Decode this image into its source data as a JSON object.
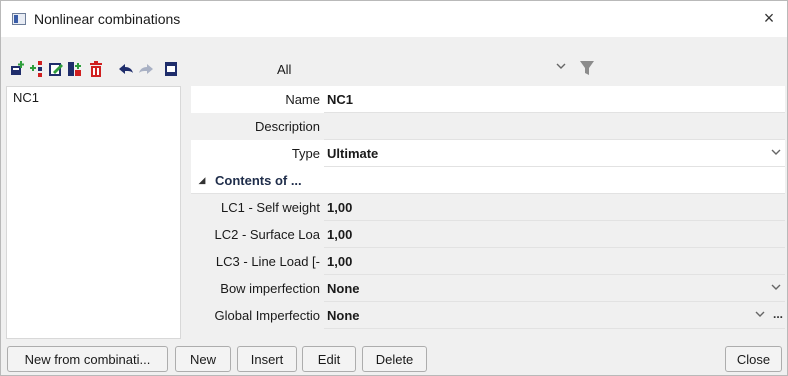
{
  "window": {
    "title": "Nonlinear combinations",
    "close_glyph": "×"
  },
  "toolbar": {
    "icons": [
      "add-icon",
      "insert-icon",
      "edit-icon",
      "copy-icon",
      "delete-icon",
      "undo-icon",
      "redo-icon",
      "window-icon",
      "filter-icon"
    ],
    "filter_value": "All",
    "accent_colors": {
      "green": "#2e9e3c",
      "red": "#d02020",
      "navy": "#1f2d6b",
      "gray": "#8c8c8c"
    }
  },
  "list": {
    "items": [
      "NC1"
    ]
  },
  "properties": {
    "name_label": "Name",
    "name_value": "NC1",
    "description_label": "Description",
    "description_value": "",
    "type_label": "Type",
    "type_value": "Ultimate",
    "section_title": "Contents of ...",
    "lc1_label": "LC1 - Self weight",
    "lc1_value": "1,00",
    "lc2_label": "LC2 - Surface Loa",
    "lc2_value": "1,00",
    "lc3_label": "LC3 - Line Load [-",
    "lc3_value": "1,00",
    "bow_label": "Bow imperfection",
    "bow_value": "None",
    "global_label": "Global Imperfectio",
    "global_value": "None",
    "more_glyph": "..."
  },
  "buttons": {
    "new_from": "New from combinati...",
    "new": "New",
    "insert": "Insert",
    "edit": "Edit",
    "delete": "Delete",
    "close": "Close"
  }
}
